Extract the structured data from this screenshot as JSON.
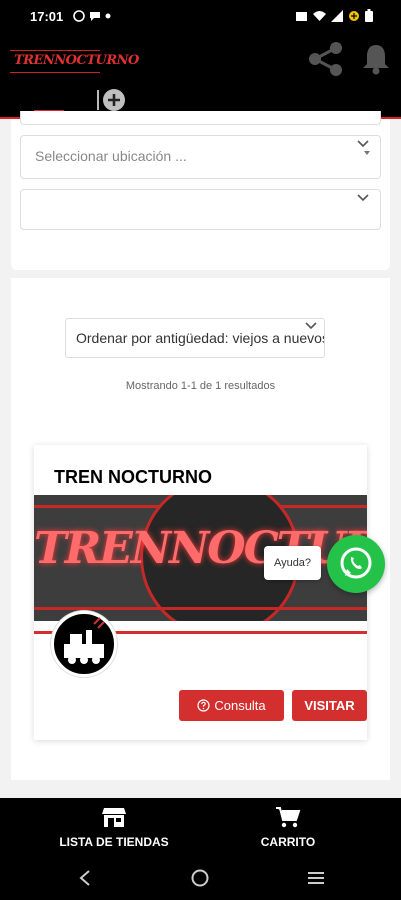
{
  "status_bar": {
    "time": "17:01",
    "left_icons": [
      "whatsapp-icon",
      "chat-icon",
      "dot-icon"
    ],
    "right_icons": [
      "alarm-icon",
      "wifi-icon",
      "signal-icon",
      "battery-saver-icon",
      "battery-icon"
    ]
  },
  "app_bar": {
    "logo_text": "TRENNOCTURNO",
    "actions": [
      "share-icon",
      "bell-icon"
    ],
    "add_tab_icon": "plus-circle-icon"
  },
  "filters": {
    "location_placeholder": "Seleccionar ubicación ...",
    "second_select_value": ""
  },
  "results": {
    "sort_selected": "Ordenar por antigüedad: viejos a nuevos",
    "count_text": "Mostrando 1-1 de 1 resultados"
  },
  "store_card": {
    "title": "TREN NOCTURNO",
    "banner_text": "TRENNOCTURNO",
    "consulta_label": "Consulta",
    "visitar_label": "VISITAR"
  },
  "floating": {
    "help_label": "Ayuda?"
  },
  "bottom_nav": {
    "items": [
      {
        "label": "LISTA DE TIENDAS",
        "icon": "store-icon"
      },
      {
        "label": "CARRITO",
        "icon": "cart-icon"
      }
    ]
  },
  "colors": {
    "accent": "#d32f2f",
    "whatsapp": "#25c24a",
    "bar": "#000000"
  }
}
